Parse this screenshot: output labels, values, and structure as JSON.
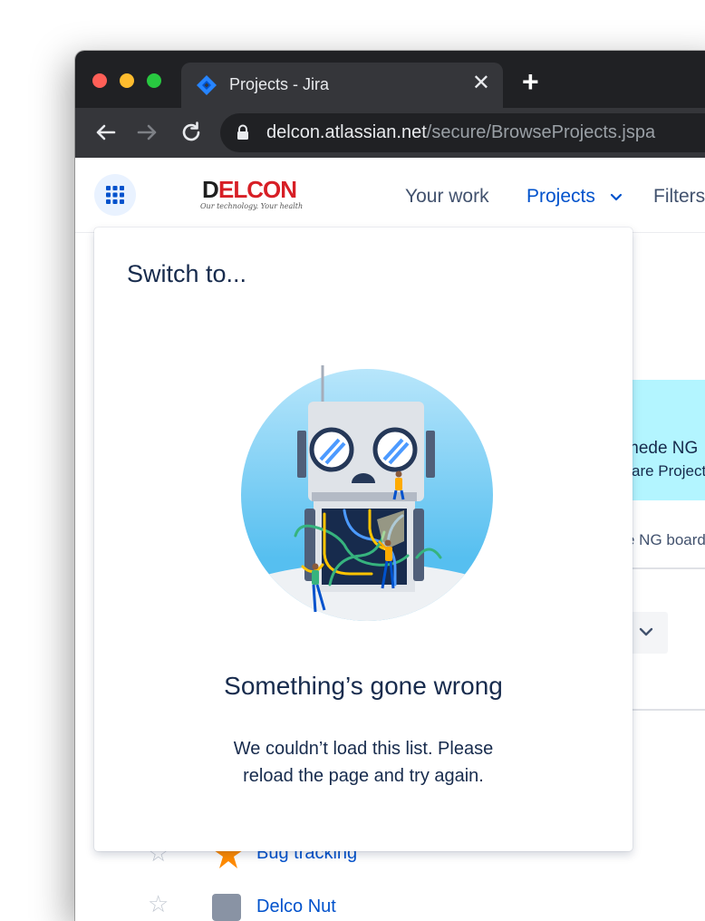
{
  "browser": {
    "tab_title": "Projects - Jira",
    "tab_close": "✕",
    "new_tab": "+",
    "url_host": "delcon.atlassian.net",
    "url_path": "/secure/BrowseProjects.jspa"
  },
  "jira": {
    "logo_text": "DELCON",
    "logo_tagline": "Our technology. Your health",
    "nav": {
      "your_work": "Your work",
      "projects": "Projects",
      "filters": "Filters"
    },
    "background": {
      "banner_line1": "mede NG",
      "banner_line2": "are Project",
      "board_text": "e NG board",
      "project_1": "Bug tracking",
      "project_2": "Delco Nut"
    }
  },
  "dropdown": {
    "title": "Switch to...",
    "error_heading": "Something’s gone wrong",
    "error_line1": "We couldn’t load this list. Please",
    "error_line2": "reload the page and try again."
  },
  "colors": {
    "accent": "#0052cc",
    "text": "#172b4d",
    "chrome_dark": "#202124",
    "chrome_tab": "#35363a"
  }
}
